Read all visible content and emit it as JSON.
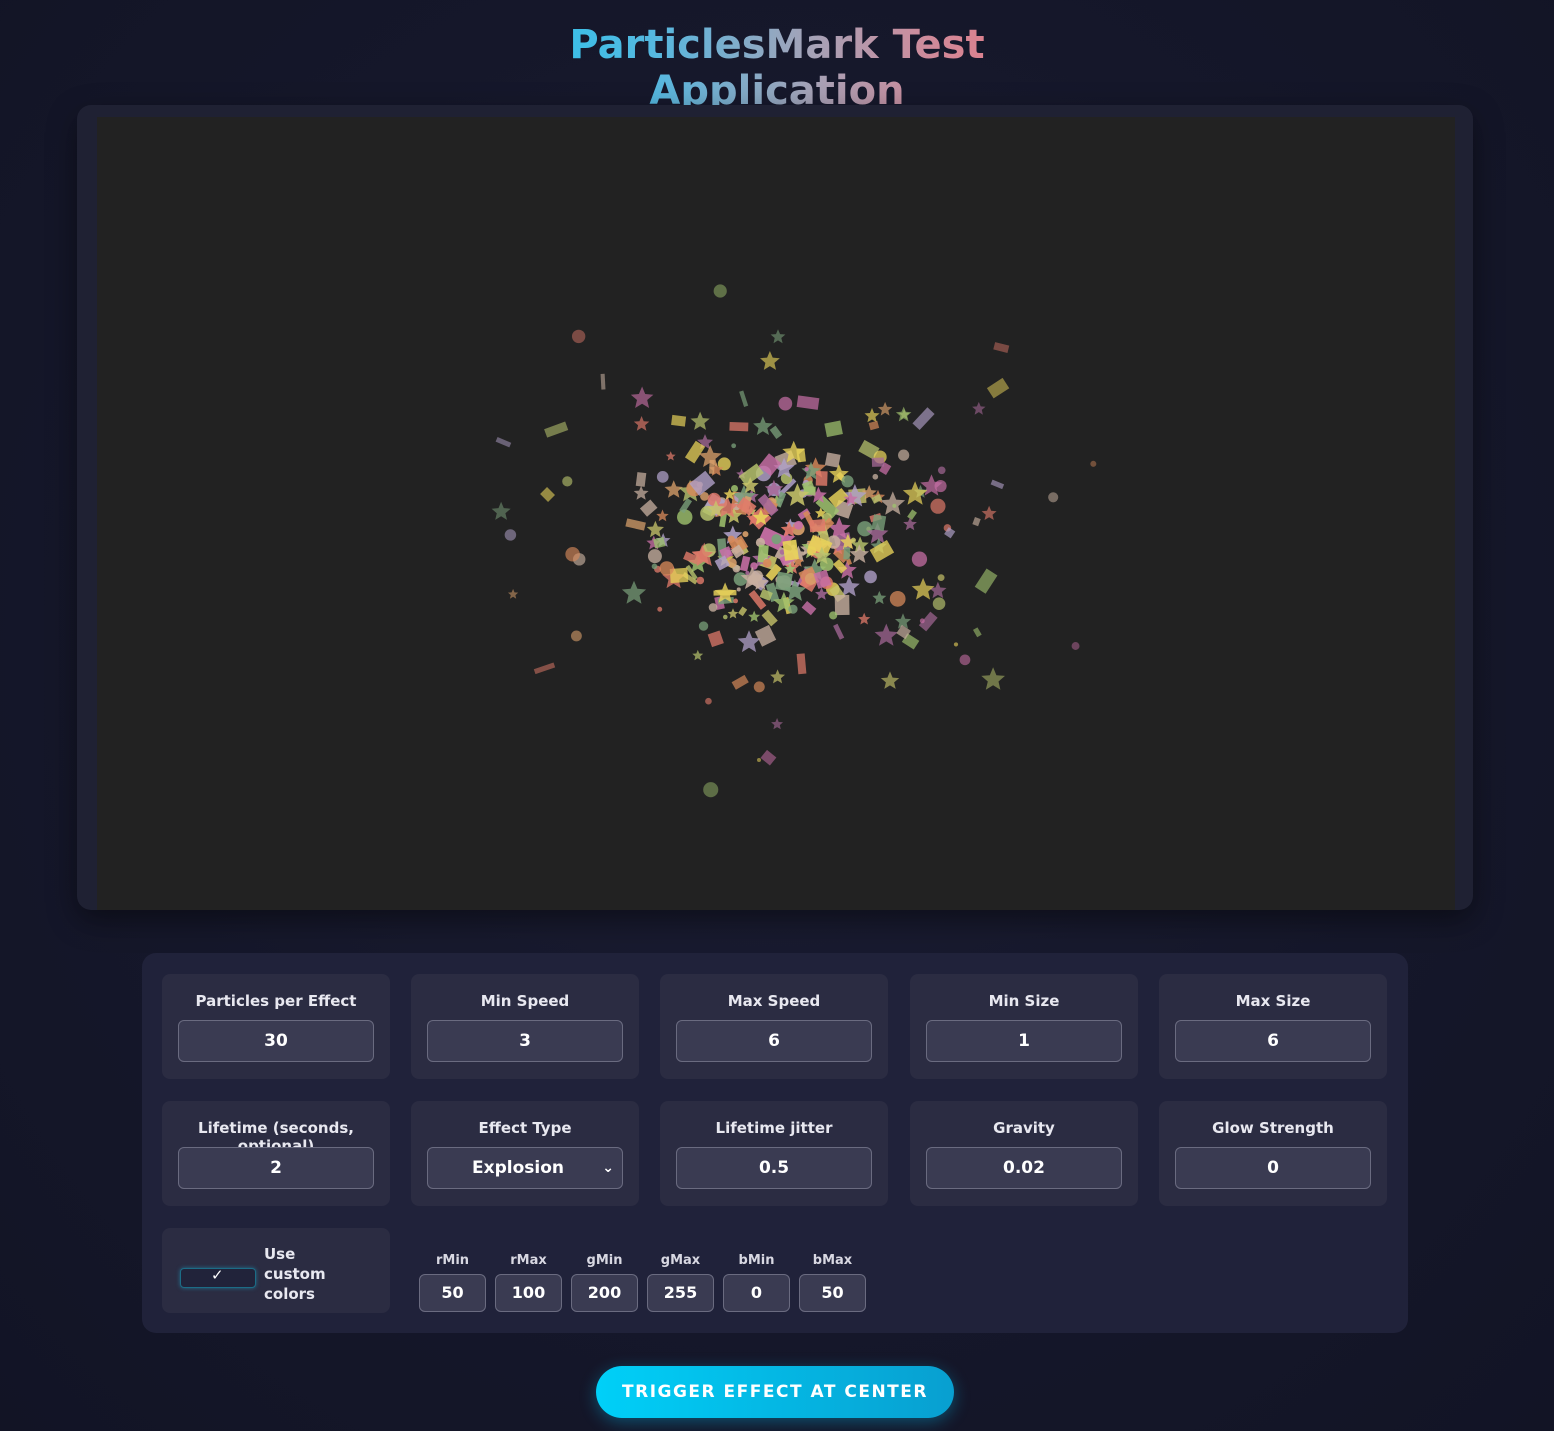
{
  "title": "ParticlesMark Test Application",
  "fields": [
    {
      "label": "Particles per Effect",
      "value": "30"
    },
    {
      "label": "Min Speed",
      "value": "3"
    },
    {
      "label": "Max Speed",
      "value": "6"
    },
    {
      "label": "Min Size",
      "value": "1"
    },
    {
      "label": "Max Size",
      "value": "6"
    },
    {
      "label": "Lifetime (seconds, optional)",
      "value": "2"
    },
    {
      "label": "Effect Type",
      "value": "Explosion"
    },
    {
      "label": "Lifetime jitter",
      "value": "0.5"
    },
    {
      "label": "Gravity",
      "value": "0.02"
    },
    {
      "label": "Glow Strength",
      "value": "0"
    }
  ],
  "custom_colors": {
    "label": "Use custom colors",
    "checked": true,
    "channels": [
      {
        "label": "rMin",
        "value": "50"
      },
      {
        "label": "rMax",
        "value": "100"
      },
      {
        "label": "gMin",
        "value": "200"
      },
      {
        "label": "gMax",
        "value": "255"
      },
      {
        "label": "bMin",
        "value": "0"
      },
      {
        "label": "bMax",
        "value": "50"
      }
    ]
  },
  "trigger_button": "TRIGGER EFFECT AT CENTER",
  "colors": {
    "accent": "#00c8f0",
    "title_gradient": [
      "#1ec8f0",
      "#f0707a"
    ],
    "canvas_bg": "#222222"
  },
  "particle_palette": [
    "#d9a06b",
    "#c8c46a",
    "#e07a6a",
    "#c86fa6",
    "#b8c46e",
    "#e8d25a",
    "#9fc26e",
    "#d88a5a",
    "#a86a9a",
    "#c8b0a0",
    "#7aa07a",
    "#b0a0c8"
  ]
}
